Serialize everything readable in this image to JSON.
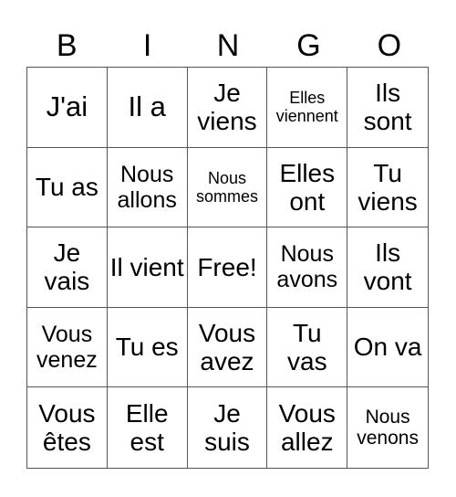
{
  "header": [
    "B",
    "I",
    "N",
    "G",
    "O"
  ],
  "cells": [
    {
      "text": "J'ai",
      "size": "xl"
    },
    {
      "text": "Il a",
      "size": "xl"
    },
    {
      "text": "Je viens",
      "size": "l"
    },
    {
      "text": "Elles viennent",
      "size": "xs"
    },
    {
      "text": "Ils sont",
      "size": "l"
    },
    {
      "text": "Tu as",
      "size": "l"
    },
    {
      "text": "Nous allons",
      "size": "m"
    },
    {
      "text": "Nous sommes",
      "size": "xs"
    },
    {
      "text": "Elles ont",
      "size": "l"
    },
    {
      "text": "Tu viens",
      "size": "l"
    },
    {
      "text": "Je vais",
      "size": "l"
    },
    {
      "text": "Il vient",
      "size": "l"
    },
    {
      "text": "Free!",
      "size": "l"
    },
    {
      "text": "Nous avons",
      "size": "m"
    },
    {
      "text": "Ils vont",
      "size": "l"
    },
    {
      "text": "Vous venez",
      "size": "m"
    },
    {
      "text": "Tu es",
      "size": "l"
    },
    {
      "text": "Vous avez",
      "size": "l"
    },
    {
      "text": "Tu vas",
      "size": "l"
    },
    {
      "text": "On va",
      "size": "l"
    },
    {
      "text": "Vous êtes",
      "size": "l"
    },
    {
      "text": "Elle est",
      "size": "l"
    },
    {
      "text": "Je suis",
      "size": "l"
    },
    {
      "text": "Vous allez",
      "size": "l"
    },
    {
      "text": "Nous venons",
      "size": "s"
    }
  ]
}
